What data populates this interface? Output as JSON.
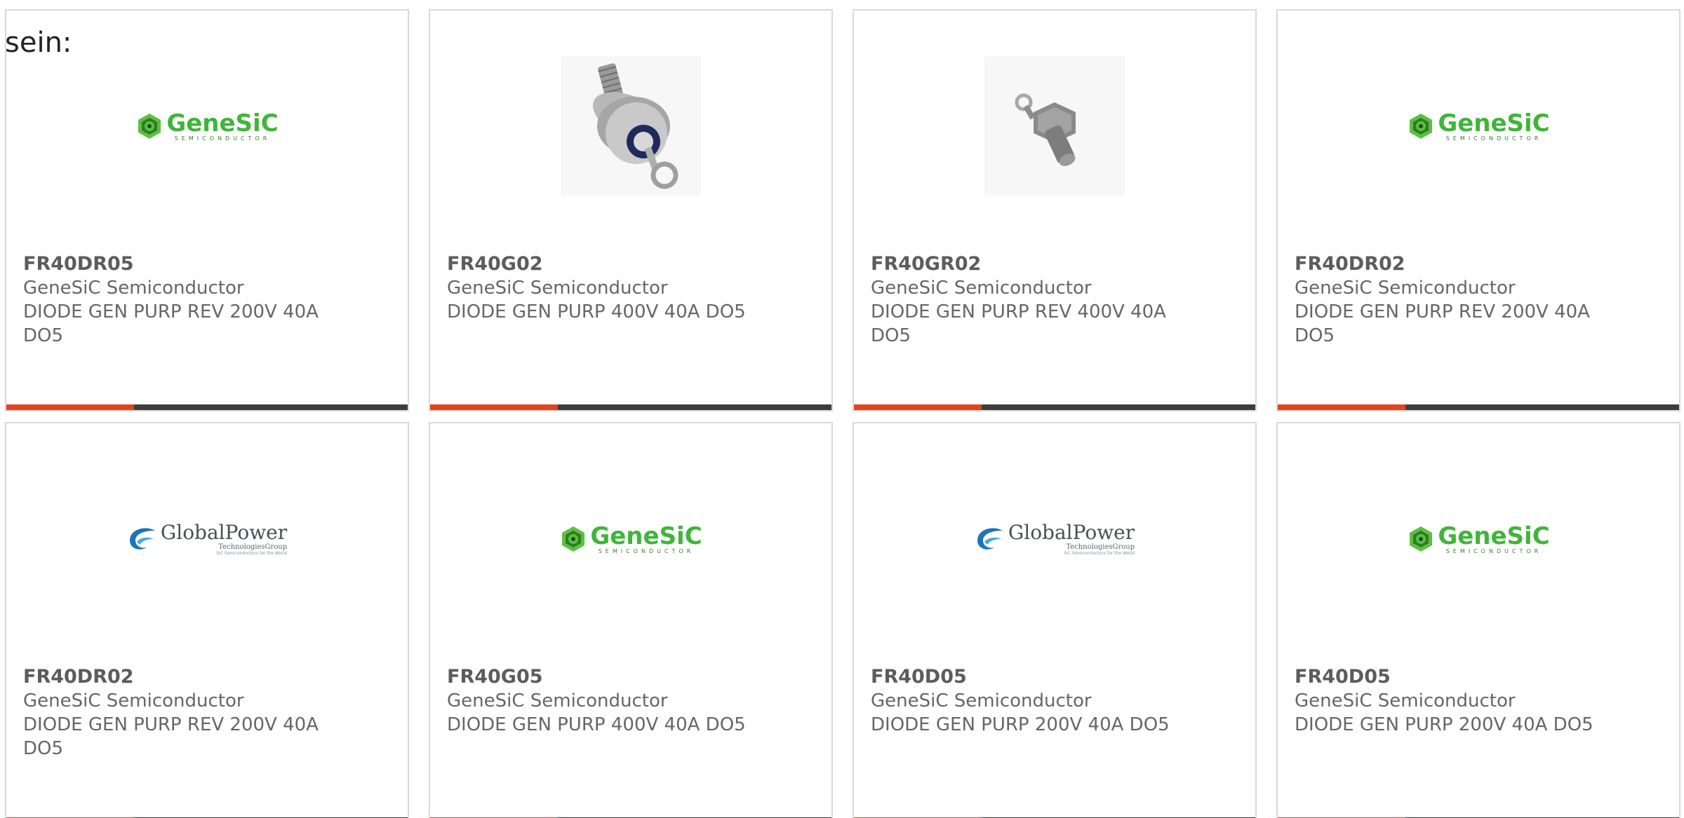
{
  "intro": "sein:",
  "accent_color": "#e8421c",
  "bar_color": "#3d3d3d",
  "logos": {
    "genesic": {
      "name": "GeneSiC",
      "sub": "SEMICONDUCTOR"
    },
    "globalpower": {
      "name": "GlobalPower",
      "sub": "TechnologiesGroup",
      "tag": "SiC Semiconductors for the World"
    }
  },
  "products": [
    {
      "part": "FR40DR05",
      "maker": "GeneSiC Semiconductor",
      "desc": "DIODE GEN PURP REV 200V 40A DO5",
      "image": "genesic-logo"
    },
    {
      "part": "FR40G02",
      "maker": "GeneSiC Semiconductor",
      "desc": "DIODE GEN PURP 400V 40A DO5",
      "image": "stud-diode-photo"
    },
    {
      "part": "FR40GR02",
      "maker": "GeneSiC Semiconductor",
      "desc": "DIODE GEN PURP REV 400V 40A DO5",
      "image": "stud-diode-photo-small"
    },
    {
      "part": "FR40DR02",
      "maker": "GeneSiC Semiconductor",
      "desc": "DIODE GEN PURP REV 200V 40A DO5",
      "image": "genesic-logo"
    },
    {
      "part": "FR40DR02",
      "maker": "GeneSiC Semiconductor",
      "desc": "DIODE GEN PURP REV 200V 40A DO5",
      "image": "globalpower-logo"
    },
    {
      "part": "FR40G05",
      "maker": "GeneSiC Semiconductor",
      "desc": "DIODE GEN PURP 400V 40A DO5",
      "image": "genesic-logo"
    },
    {
      "part": "FR40D05",
      "maker": "GeneSiC Semiconductor",
      "desc": "DIODE GEN PURP 200V 40A DO5",
      "image": "globalpower-logo"
    },
    {
      "part": "FR40D05",
      "maker": "GeneSiC Semiconductor",
      "desc": "DIODE GEN PURP 200V 40A DO5",
      "image": "genesic-logo"
    }
  ]
}
